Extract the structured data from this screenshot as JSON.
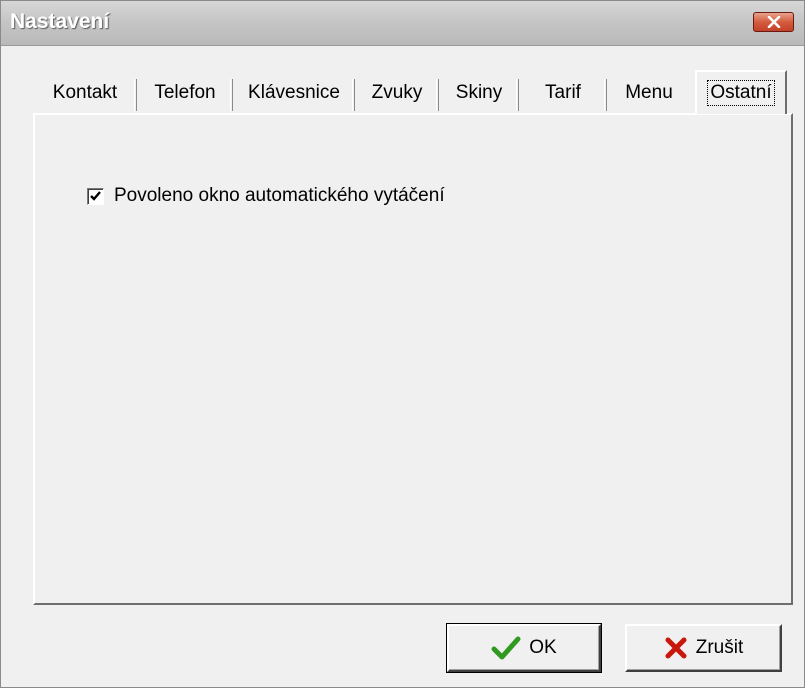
{
  "window": {
    "title": "Nastavení"
  },
  "tabs": [
    {
      "label": "Kontakt",
      "active": false
    },
    {
      "label": "Telefon",
      "active": false
    },
    {
      "label": "Klávesnice",
      "active": false
    },
    {
      "label": "Zvuky",
      "active": false
    },
    {
      "label": "Skiny",
      "active": false
    },
    {
      "label": "Tarif",
      "active": false
    },
    {
      "label": "Menu",
      "active": false
    },
    {
      "label": "Ostatní",
      "active": true
    }
  ],
  "options": {
    "auto_dial_window": {
      "label": "Povoleno okno automatického vytáčení",
      "checked": true
    }
  },
  "buttons": {
    "ok_label": "OK",
    "cancel_label": "Zrušit"
  },
  "icons": {
    "ok": "checkmark-icon",
    "cancel": "x-icon",
    "close": "close-icon"
  },
  "colors": {
    "ok_icon": "#2f9a1f",
    "cancel_icon": "#c8180e",
    "close_button": "#d45b3e"
  }
}
